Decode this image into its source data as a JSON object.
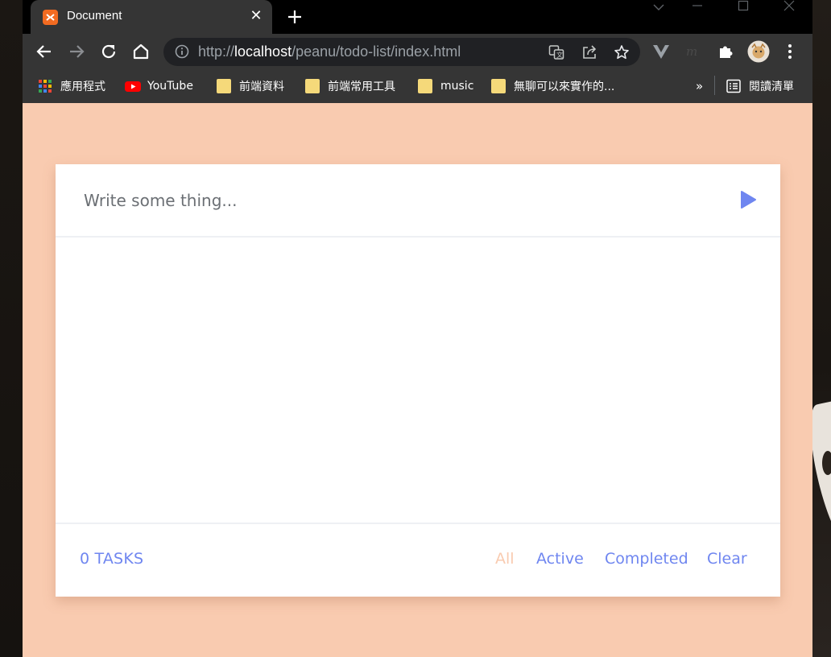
{
  "browser": {
    "tab_title": "Document",
    "url_prefix": "http://",
    "url_host": "localhost",
    "url_path": "/peanu/todo-list/index.html"
  },
  "bookmarks": {
    "items": [
      {
        "label": "應用程式",
        "icon": "apps-grid-icon"
      },
      {
        "label": "YouTube",
        "icon": "youtube-icon"
      },
      {
        "label": "前端資料",
        "icon": "folder-icon"
      },
      {
        "label": "前端常用工具",
        "icon": "folder-icon"
      },
      {
        "label": "music",
        "icon": "folder-icon"
      },
      {
        "label": "無聊可以來實作的...",
        "icon": "folder-icon"
      }
    ],
    "overflow": "»",
    "reading_list": "閱讀清單"
  },
  "todo": {
    "input_placeholder": "Write some thing...",
    "input_value": "",
    "task_count": "0 TASKS",
    "filters": {
      "all": "All",
      "active": "Active",
      "completed": "Completed",
      "clear": "Clear"
    },
    "selected_filter": "all"
  },
  "colors": {
    "page_background": "#f9cbb0",
    "accent": "#6f86f0",
    "card": "#ffffff",
    "browser_chrome": "#353535"
  }
}
